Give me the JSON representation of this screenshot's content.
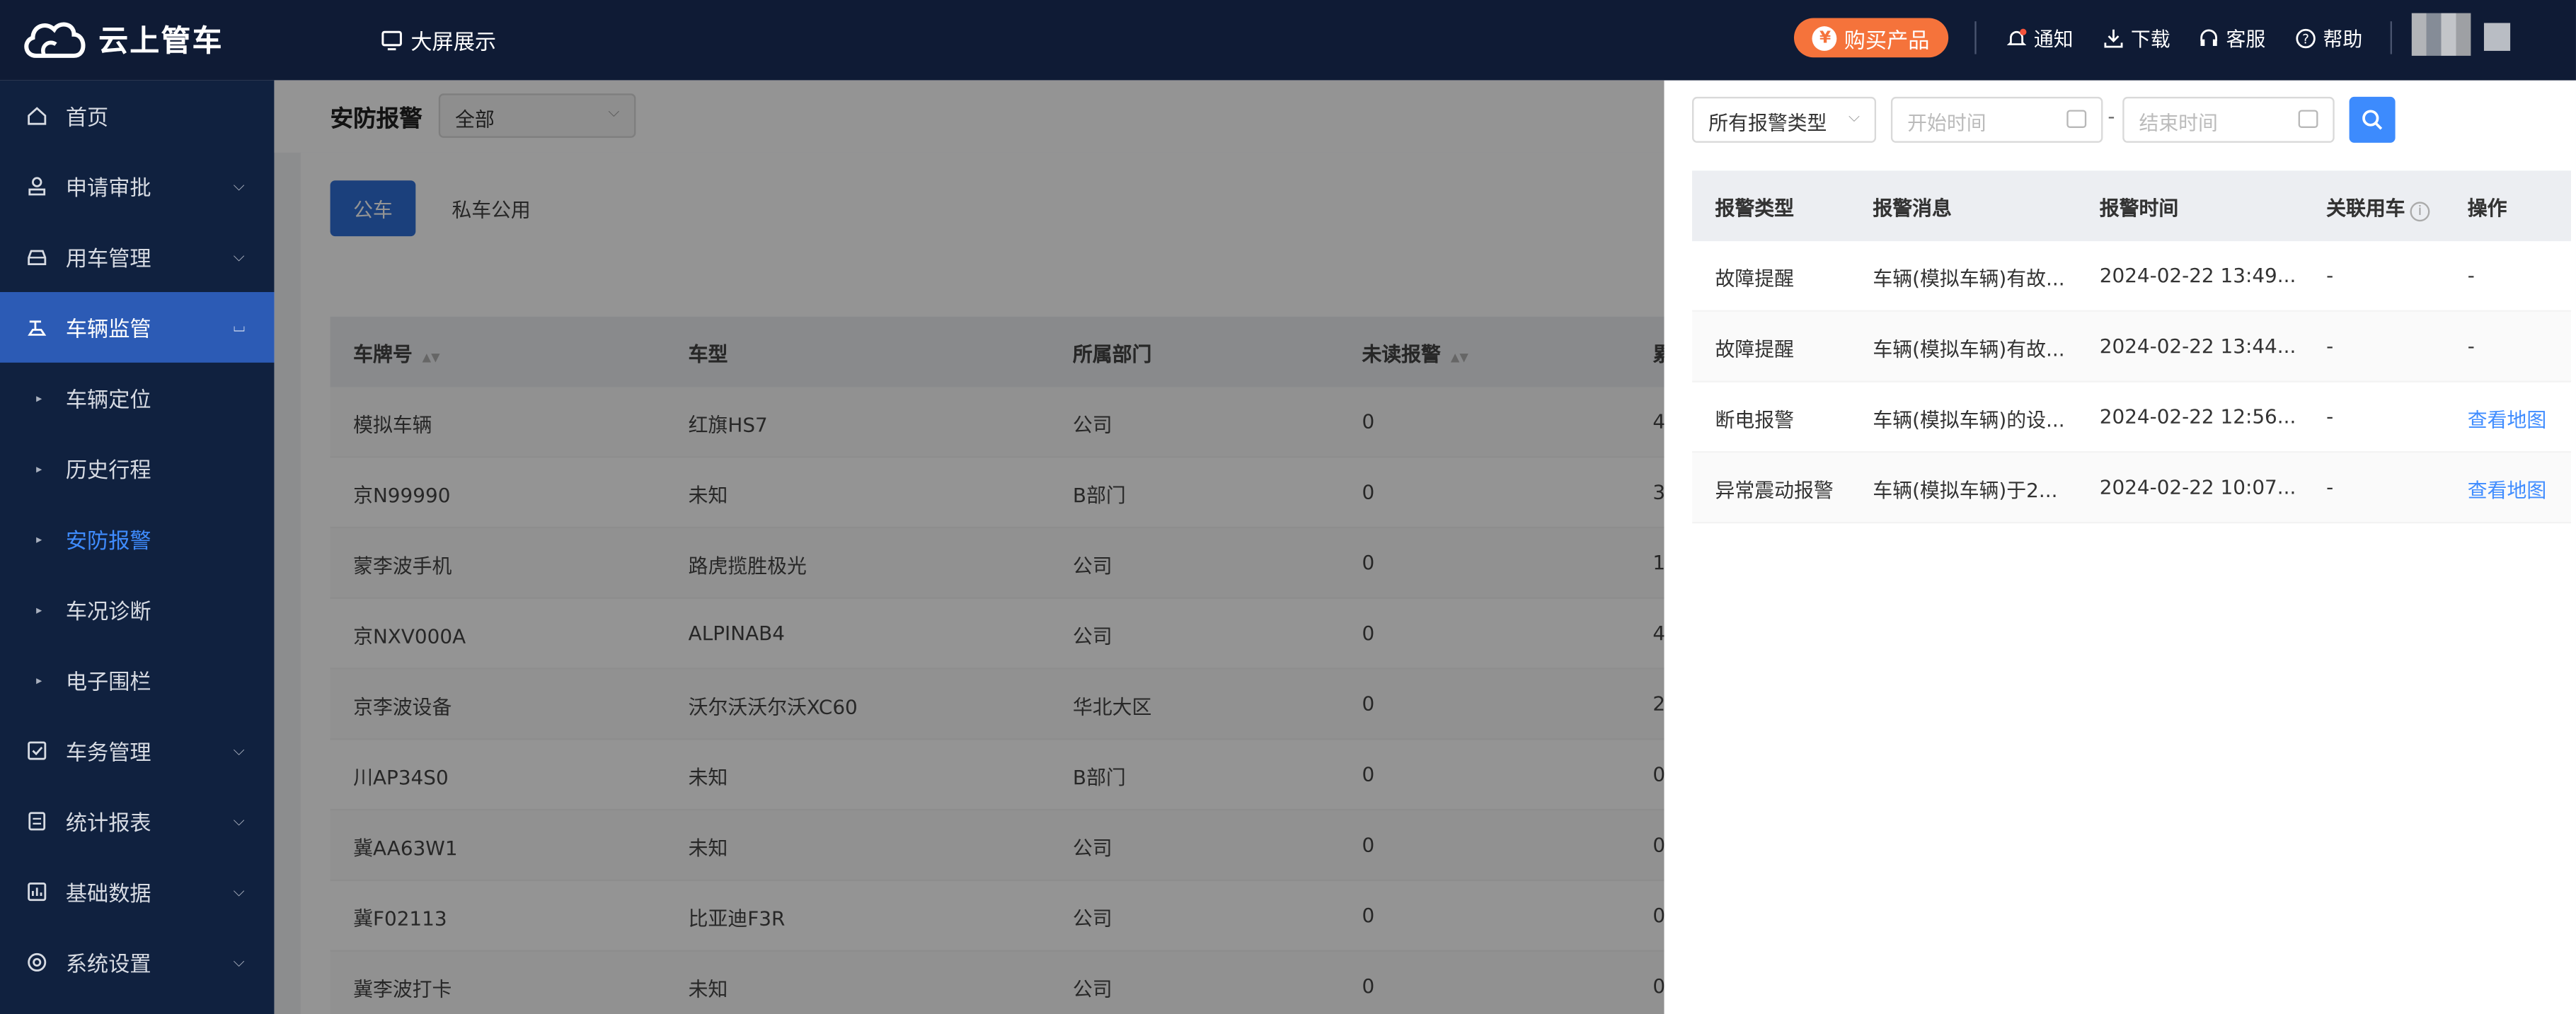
{
  "header": {
    "logo_text": "云上管车",
    "bigscreen_label": "大屏展示",
    "buy_label": "购买产品",
    "buy_icon_text": "¥",
    "links": {
      "notice": "通知",
      "download": "下载",
      "service": "客服",
      "help": "帮助"
    }
  },
  "sidebar": {
    "items": [
      {
        "label": "首页",
        "icon": "home-icon"
      },
      {
        "label": "申请审批",
        "icon": "stamp-icon",
        "expandable": true
      },
      {
        "label": "用车管理",
        "icon": "car-icon",
        "expandable": true
      },
      {
        "label": "车辆监管",
        "icon": "monitor-icon",
        "expandable": true,
        "expanded": true,
        "active": true
      },
      {
        "label": "车辆定位",
        "sub": true
      },
      {
        "label": "历史行程",
        "sub": true
      },
      {
        "label": "安防报警",
        "sub": true,
        "selected": true
      },
      {
        "label": "车况诊断",
        "sub": true
      },
      {
        "label": "电子围栏",
        "sub": true
      },
      {
        "label": "车务管理",
        "icon": "checklist-icon",
        "expandable": true
      },
      {
        "label": "统计报表",
        "icon": "report-icon",
        "expandable": true
      },
      {
        "label": "基础数据",
        "icon": "chart-icon",
        "expandable": true
      },
      {
        "label": "系统设置",
        "icon": "settings-icon",
        "expandable": true
      }
    ]
  },
  "main": {
    "title": "安防报警",
    "filter_value": "全部",
    "tabs": [
      "公车",
      "私车公用"
    ],
    "columns": [
      "车牌号",
      "车型",
      "所属部门",
      "未读报警",
      "累"
    ],
    "rows": [
      [
        "模拟车辆",
        "红旗HS7",
        "公司",
        "0",
        "4"
      ],
      [
        "京N99990",
        "未知",
        "B部门",
        "0",
        "3"
      ],
      [
        "蒙李波手机",
        "路虎揽胜极光",
        "公司",
        "0",
        "1"
      ],
      [
        "京NXV000A",
        "ALPINAB4",
        "公司",
        "0",
        "4"
      ],
      [
        "京李波设备",
        "沃尔沃沃尔沃XC60",
        "华北大区",
        "0",
        "2"
      ],
      [
        "川AP34S0",
        "未知",
        "B部门",
        "0",
        "0"
      ],
      [
        "冀AA63W1",
        "未知",
        "公司",
        "0",
        "0"
      ],
      [
        "冀F02113",
        "比亚迪F3R",
        "公司",
        "0",
        "0"
      ],
      [
        "冀李波打卡",
        "未知",
        "公司",
        "0",
        "0"
      ]
    ]
  },
  "drawer": {
    "type_select": "所有报警类型",
    "start_placeholder": "开始时间",
    "end_placeholder": "结束时间",
    "range_sep": "-",
    "columns": [
      "报警类型",
      "报警消息",
      "报警时间",
      "关联用车",
      "操作"
    ],
    "rows": [
      {
        "type": "故障提醒",
        "msg": "车辆(模拟车辆)有故...",
        "time": "2024-02-22 13:49...",
        "car": "-",
        "op": "-"
      },
      {
        "type": "故障提醒",
        "msg": "车辆(模拟车辆)有故...",
        "time": "2024-02-22 13:44...",
        "car": "-",
        "op": "-"
      },
      {
        "type": "断电报警",
        "msg": "车辆(模拟车辆)的设...",
        "time": "2024-02-22 12:56...",
        "car": "-",
        "op": "查看地图"
      },
      {
        "type": "异常震动报警",
        "msg": "车辆(模拟车辆)于2...",
        "time": "2024-02-22 10:07...",
        "car": "-",
        "op": "查看地图"
      }
    ]
  },
  "colors": {
    "topbar": "#0f1b35",
    "sidebar": "#10213f",
    "active": "#2c5bb5",
    "accent": "#3d8bfd",
    "buy": "#f5733b"
  }
}
